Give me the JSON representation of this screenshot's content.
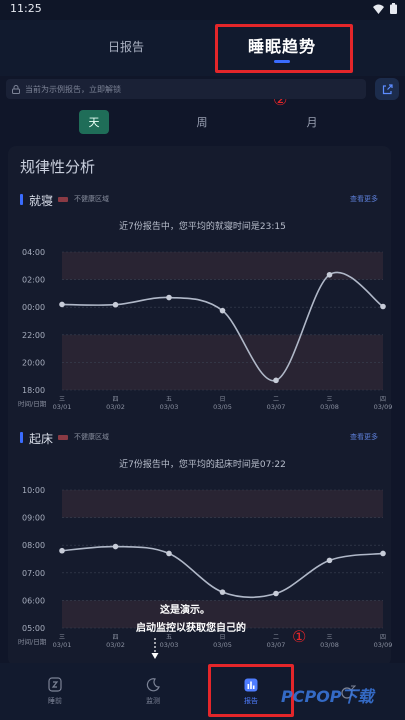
{
  "status_bar": {
    "time": "11:25"
  },
  "header": {
    "tab_daily": "日报告",
    "tab_trend": "睡眠趋势"
  },
  "notice": {
    "text": "当前为示例报告，立即解锁"
  },
  "periods": [
    "天",
    "周",
    "月"
  ],
  "card_title": "规律性分析",
  "annotations": {
    "one": "①",
    "two": "②"
  },
  "legend_label": "不健康区域",
  "see_more": "查看更多",
  "bedtime": {
    "title": "就寝",
    "summary": "近7份报告中，您平均的就寝时间是23:15"
  },
  "wakeup": {
    "title": "起床",
    "summary": "近7份报告中，您平均的起床时间是07:22"
  },
  "chart_data": [
    {
      "type": "line",
      "title": "就寝",
      "y_ticks": [
        "04:00",
        "02:00",
        "00:00",
        "22:00",
        "20:00",
        "18:00"
      ],
      "ylim_hours": [
        18,
        28
      ],
      "corner_label": "时间/日期",
      "categories": [
        "03/01",
        "03/02",
        "03/03",
        "03/05",
        "03/07",
        "03/08",
        "03/09"
      ],
      "weekdays": [
        "三",
        "四",
        "五",
        "日",
        "二",
        "三",
        "四"
      ],
      "values_hours": [
        24.2,
        24.18,
        24.7,
        23.75,
        18.7,
        26.35,
        24.05
      ],
      "unhealthy_bands_hours": [
        [
          26,
          28
        ],
        [
          18,
          22
        ]
      ],
      "color": "#b0b8c8"
    },
    {
      "type": "line",
      "title": "起床",
      "y_ticks": [
        "10:00",
        "09:00",
        "08:00",
        "07:00",
        "06:00",
        "05:00"
      ],
      "ylim_hours": [
        5,
        10
      ],
      "corner_label": "时间/日期",
      "categories": [
        "03/01",
        "03/02",
        "03/03",
        "03/05",
        "03/07",
        "03/08",
        "03/09"
      ],
      "weekdays": [
        "三",
        "四",
        "五",
        "日",
        "二",
        "三",
        "四"
      ],
      "values_hours": [
        7.8,
        7.95,
        7.7,
        6.3,
        6.25,
        7.45,
        7.7
      ],
      "unhealthy_bands_hours": [
        [
          9,
          10
        ],
        [
          5,
          6
        ]
      ],
      "color": "#b0b8c8"
    }
  ],
  "demo_overlay": {
    "line1": "这是演示。",
    "line2": "启动监控以获取您自己的"
  },
  "bottom_nav": [
    {
      "label": "睡前",
      "icon": "sleep-before-icon"
    },
    {
      "label": "监测",
      "icon": "moon-icon"
    },
    {
      "label": "报告",
      "icon": "report-icon",
      "active": true
    },
    {
      "label": "",
      "icon": "snore-icon"
    }
  ],
  "watermark": "PCPOP下载",
  "colors": {
    "accent": "#3a6cff",
    "active_period": "#1f6d58",
    "annotation": "#e4262a",
    "unhealthy": "#8a3a44"
  }
}
